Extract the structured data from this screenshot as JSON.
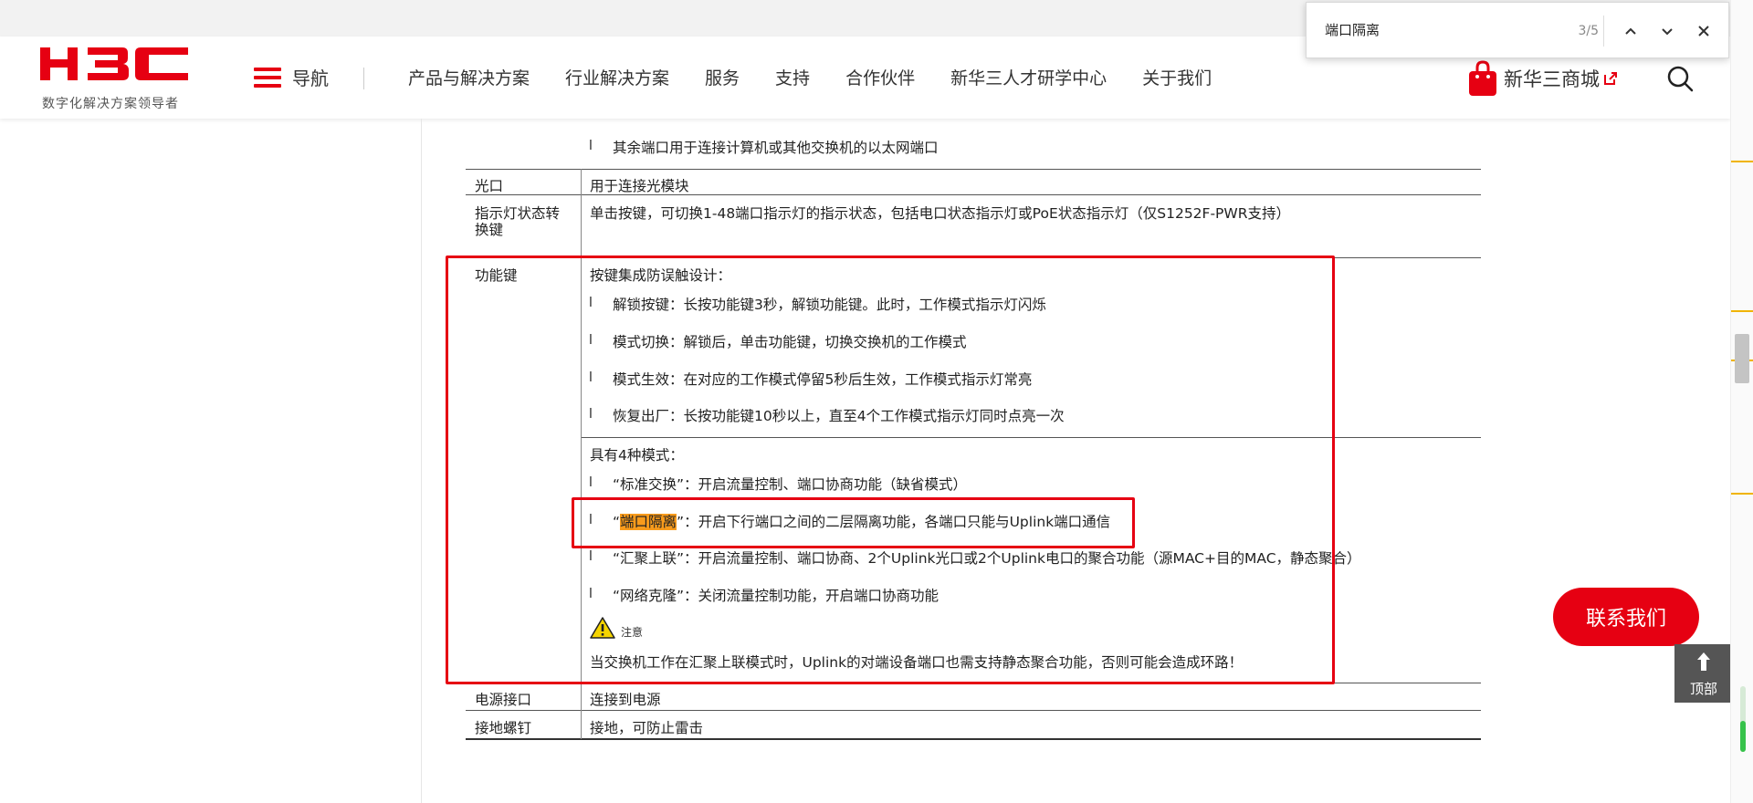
{
  "header": {
    "logo_text": "H3C",
    "logo_subtitle": "数字化解决方案领导者",
    "nav_label": "导航",
    "menu": [
      "产品与解决方案",
      "行业解决方案",
      "服务",
      "支持",
      "合作伙伴",
      "新华三人才研学中心",
      "关于我们"
    ],
    "shop_label": "新华三商城",
    "brand_color": "#e60012"
  },
  "findbar": {
    "query": "端口隔离",
    "count": "3/5"
  },
  "table": {
    "row_ethernet_continued": "其余端口用于连接计算机或其他交换机的以太网端口",
    "row_optical": {
      "label": "光口",
      "desc": "用于连接光模块"
    },
    "row_led_switch": {
      "label_line1": "指示灯状态转",
      "label_line2": "换键",
      "desc": "单击按键，可切换1-48端口指示灯的指示状态，包括电口状态指示灯或PoE状态指示灯（仅S1252F-PWR支持）"
    },
    "row_function": {
      "label": "功能键",
      "design_title": "按键集成防误触设计：",
      "design_items": [
        "解锁按键：长按功能键3秒，解锁功能键。此时，工作模式指示灯闪烁",
        "模式切换：解锁后，单击功能键，切换交换机的工作模式",
        "模式生效：在对应的工作模式停留5秒后生效，工作模式指示灯常亮",
        "恢复出厂：长按功能键10秒以上，直至4个工作模式指示灯同时点亮一次"
      ],
      "modes_title": "具有4种模式：",
      "mode_standard": "“标准交换”：开启流量控制、端口协商功能（缺省模式）",
      "mode_isolation_open": "“",
      "mode_isolation_highlight": "端口隔离",
      "mode_isolation_rest": "”：开启下行端口之间的二层隔离功能，各端口只能与Uplink端口通信",
      "mode_aggregation": "“汇聚上联”：开启流量控制、端口协商、2个Uplink光口或2个Uplink电口的聚合功能（源MAC+目的MAC，静态聚合）",
      "mode_clone": "“网络克隆”：关闭流量控制功能，开启端口协商功能",
      "note_label": "注意",
      "note_text": "当交换机工作在汇聚上联模式时，Uplink的对端设备端口也需支持静态聚合功能，否则可能会造成环路！"
    },
    "row_power": {
      "label": "电源接口",
      "desc": "连接到电源"
    },
    "row_ground": {
      "label": "接地螺钉",
      "desc": "接地，可防止雷击"
    },
    "bullet_char": "l"
  },
  "floating": {
    "contact_label": "联系我们",
    "top_label": "顶部"
  },
  "colors": {
    "highlight": "#f89b1c",
    "annotation_box": "#e60012",
    "warning": "#f5d400"
  }
}
